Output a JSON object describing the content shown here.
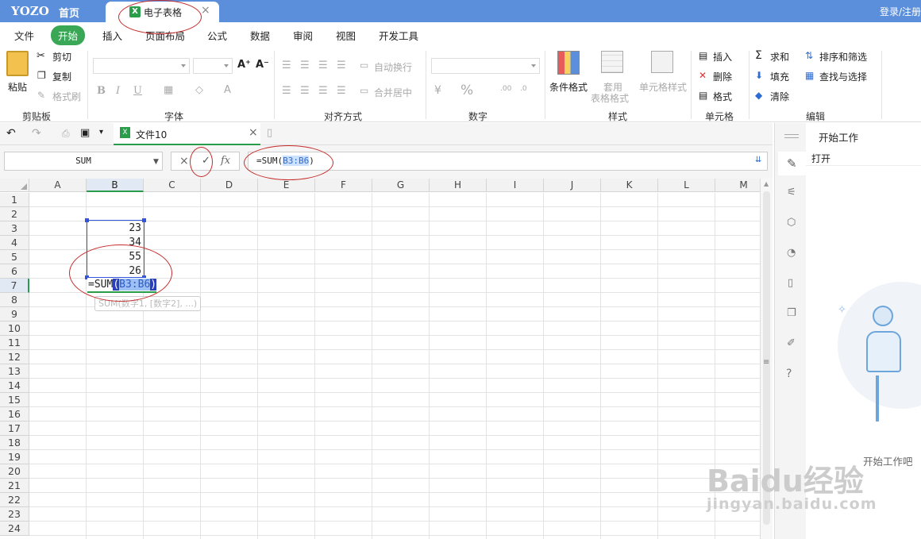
{
  "titlebar": {
    "logo": "YOZO",
    "home": "首页",
    "tab_name": "电子表格",
    "tab_close": "×",
    "login": "登录/注册"
  },
  "menu": [
    "文件",
    "开始",
    "插入",
    "页面布局",
    "公式",
    "数据",
    "审阅",
    "视图",
    "开发工具"
  ],
  "ribbon": {
    "clipboard": {
      "cut": "剪切",
      "copy": "复制",
      "format_painter": "格式刷",
      "paste": "粘贴",
      "label": "剪贴板"
    },
    "font": {
      "label": "字体",
      "bold": "B",
      "italic": "I",
      "underline": "U",
      "grow": "A⁺",
      "shrink": "A⁻"
    },
    "align": {
      "wrap": "自动换行",
      "merge": "合并居中",
      "label": "对齐方式"
    },
    "number": {
      "currency": "¥",
      "percent": "%",
      "label": "数字"
    },
    "styles": {
      "cond": "条件格式",
      "table1": "套用",
      "table2": "表格格式",
      "cell_style": "单元格样式",
      "label": "样式"
    },
    "cells": {
      "insert": "插入",
      "delete": "删除",
      "format": "格式",
      "label": "单元格"
    },
    "edit": {
      "sum": "求和",
      "fill": "填充",
      "clear": "清除",
      "sort": "排序和筛选",
      "find": "查找与选择",
      "label": "编辑"
    }
  },
  "filetab": {
    "name": "文件10",
    "close": "×"
  },
  "formula_bar": {
    "name_box": "SUM",
    "cancel": "×",
    "confirm": "✓",
    "fx": "fx",
    "prefix": "=SUM(",
    "range": "B3:B6",
    "suffix": ")"
  },
  "columns": [
    "A",
    "B",
    "C",
    "D",
    "E",
    "F",
    "G",
    "H",
    "I",
    "J",
    "K",
    "L",
    "M"
  ],
  "rows": [
    "1",
    "2",
    "3",
    "4",
    "5",
    "6",
    "7",
    "8",
    "9",
    "10",
    "11",
    "12",
    "13",
    "14",
    "15",
    "16",
    "17",
    "18",
    "19",
    "20",
    "21",
    "22",
    "23",
    "24"
  ],
  "cells": {
    "B3": "23",
    "B4": "34",
    "B5": "55",
    "B6": "26"
  },
  "edit_cell": {
    "prefix": "=SUM",
    "open": "(",
    "range": "B3:B6",
    "close": ")"
  },
  "tooltip": "SUM(数字1, [数字2], ...)",
  "panel": {
    "title": "开始工作",
    "open": "打开",
    "empty": "开始工作吧"
  },
  "watermark": {
    "brand": "Baidu经验",
    "url": "jingyan.baidu.com"
  }
}
